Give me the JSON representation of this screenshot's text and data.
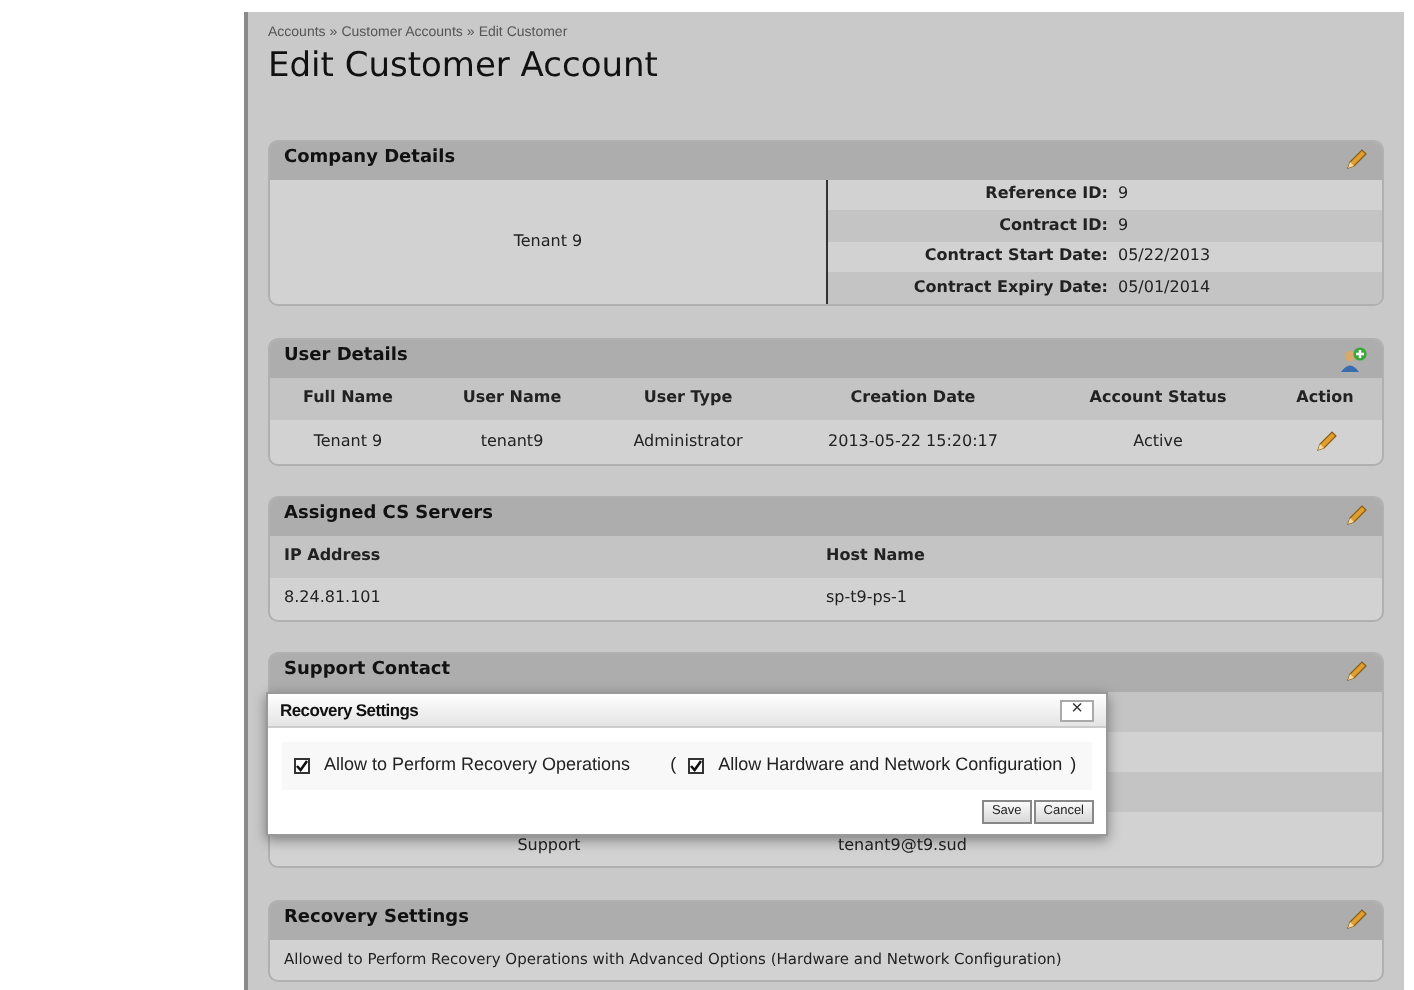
{
  "breadcrumb": [
    "Accounts",
    "Customer Accounts",
    "Edit Customer"
  ],
  "breadcrumb_separator": "»",
  "title": "Edit Customer Account",
  "company_details": {
    "title": "Company Details",
    "name": "Tenant 9",
    "fields": [
      {
        "label": "Reference ID:",
        "value": "9"
      },
      {
        "label": "Contract ID:",
        "value": "9"
      },
      {
        "label": "Contract Start Date:",
        "value": "05/22/2013"
      },
      {
        "label": "Contract Expiry Date:",
        "value": "05/01/2014"
      }
    ]
  },
  "user_details": {
    "title": "User Details",
    "columns": [
      "Full Name",
      "User Name",
      "User Type",
      "Creation Date",
      "Account Status",
      "Action"
    ],
    "rows": [
      [
        "Tenant 9",
        "tenant9",
        "Administrator",
        "2013-05-22 15:20:17",
        "Active"
      ]
    ]
  },
  "assigned_cs_servers": {
    "title": "Assigned CS Servers",
    "columns": [
      "IP Address",
      "Host Name"
    ],
    "rows": [
      [
        "8.24.81.101",
        "sp-t9-ps-1"
      ]
    ]
  },
  "support_contact": {
    "title": "Support Contact",
    "last_row": [
      "Support",
      "tenant9@t9.sud"
    ]
  },
  "recovery_settings": {
    "title": "Recovery Settings",
    "text": "Allowed to Perform Recovery Operations with Advanced Options (Hardware and Network Configuration)"
  },
  "dialog": {
    "title": "Recovery Settings",
    "close": "×",
    "open_paren": "(",
    "close_paren": ")",
    "options": [
      {
        "label": "Allow to Perform Recovery Operations",
        "checked": true
      },
      {
        "label": "Allow Hardware and Network Configuration",
        "checked": true
      }
    ],
    "buttons": [
      "Save",
      "Cancel"
    ]
  }
}
